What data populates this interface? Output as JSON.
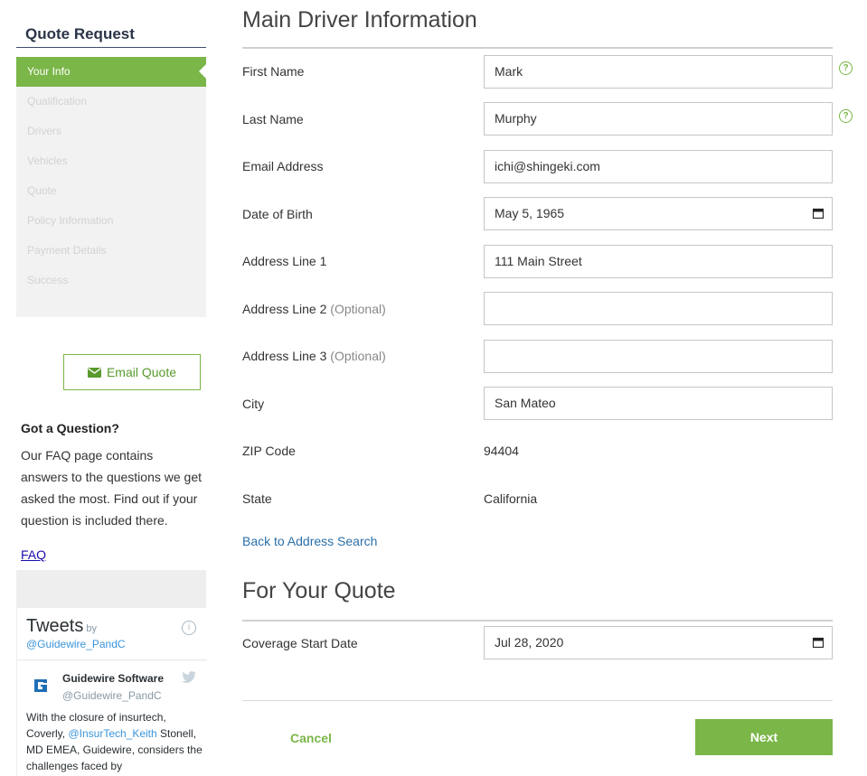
{
  "sidebar": {
    "title": "Quote Request",
    "steps": [
      "Your Info",
      "Qualification",
      "Drivers",
      "Vehicles",
      "Quote",
      "Policy Information",
      "Payment Details",
      "Success"
    ],
    "email_button": "Email Quote",
    "faq_title": "Got a Question?",
    "faq_text": "Our FAQ page contains answers to the questions we get asked the most. Find out if your question is included there.",
    "faq_link": "FAQ"
  },
  "tweets": {
    "title": "Tweets",
    "by": "by",
    "handle": "@Guidewire_PandC",
    "author_name": "Guidewire Software",
    "author_handle": "@Guidewire_PandC",
    "text_1": "With the closure of insurtech, Coverly, ",
    "mention": "@InsurTech_Keith",
    "text_2": " Stonell, MD EMEA, Guidewire, considers the challenges faced by"
  },
  "main": {
    "section1_title": "Main Driver Information",
    "fields": {
      "first_name": {
        "label": "First Name",
        "value": "Mark"
      },
      "last_name": {
        "label": "Last Name",
        "value": "Murphy"
      },
      "email": {
        "label": "Email Address",
        "value": "ichi@shingeki.com"
      },
      "dob": {
        "label": "Date of Birth",
        "value": "May 5, 1965"
      },
      "address1": {
        "label": "Address Line 1",
        "value": "111 Main Street"
      },
      "address2": {
        "label": "Address Line 2",
        "optional": "(Optional)",
        "value": ""
      },
      "address3": {
        "label": "Address Line 3",
        "optional": "(Optional)",
        "value": ""
      },
      "city": {
        "label": "City",
        "value": "San Mateo"
      },
      "zip": {
        "label": "ZIP Code",
        "value": "94404"
      },
      "state": {
        "label": "State",
        "value": "California"
      }
    },
    "back_link": "Back to Address Search",
    "section2_title": "For Your Quote",
    "coverage": {
      "label": "Coverage Start Date",
      "value": "Jul 28, 2020"
    },
    "cancel_label": "Cancel",
    "next_label": "Next"
  },
  "colors": {
    "accent": "#7ab648",
    "link": "#2a6fa8"
  },
  "icons": {
    "help": "question-circle-icon",
    "calendar": "calendar-icon",
    "email": "envelope-icon"
  }
}
